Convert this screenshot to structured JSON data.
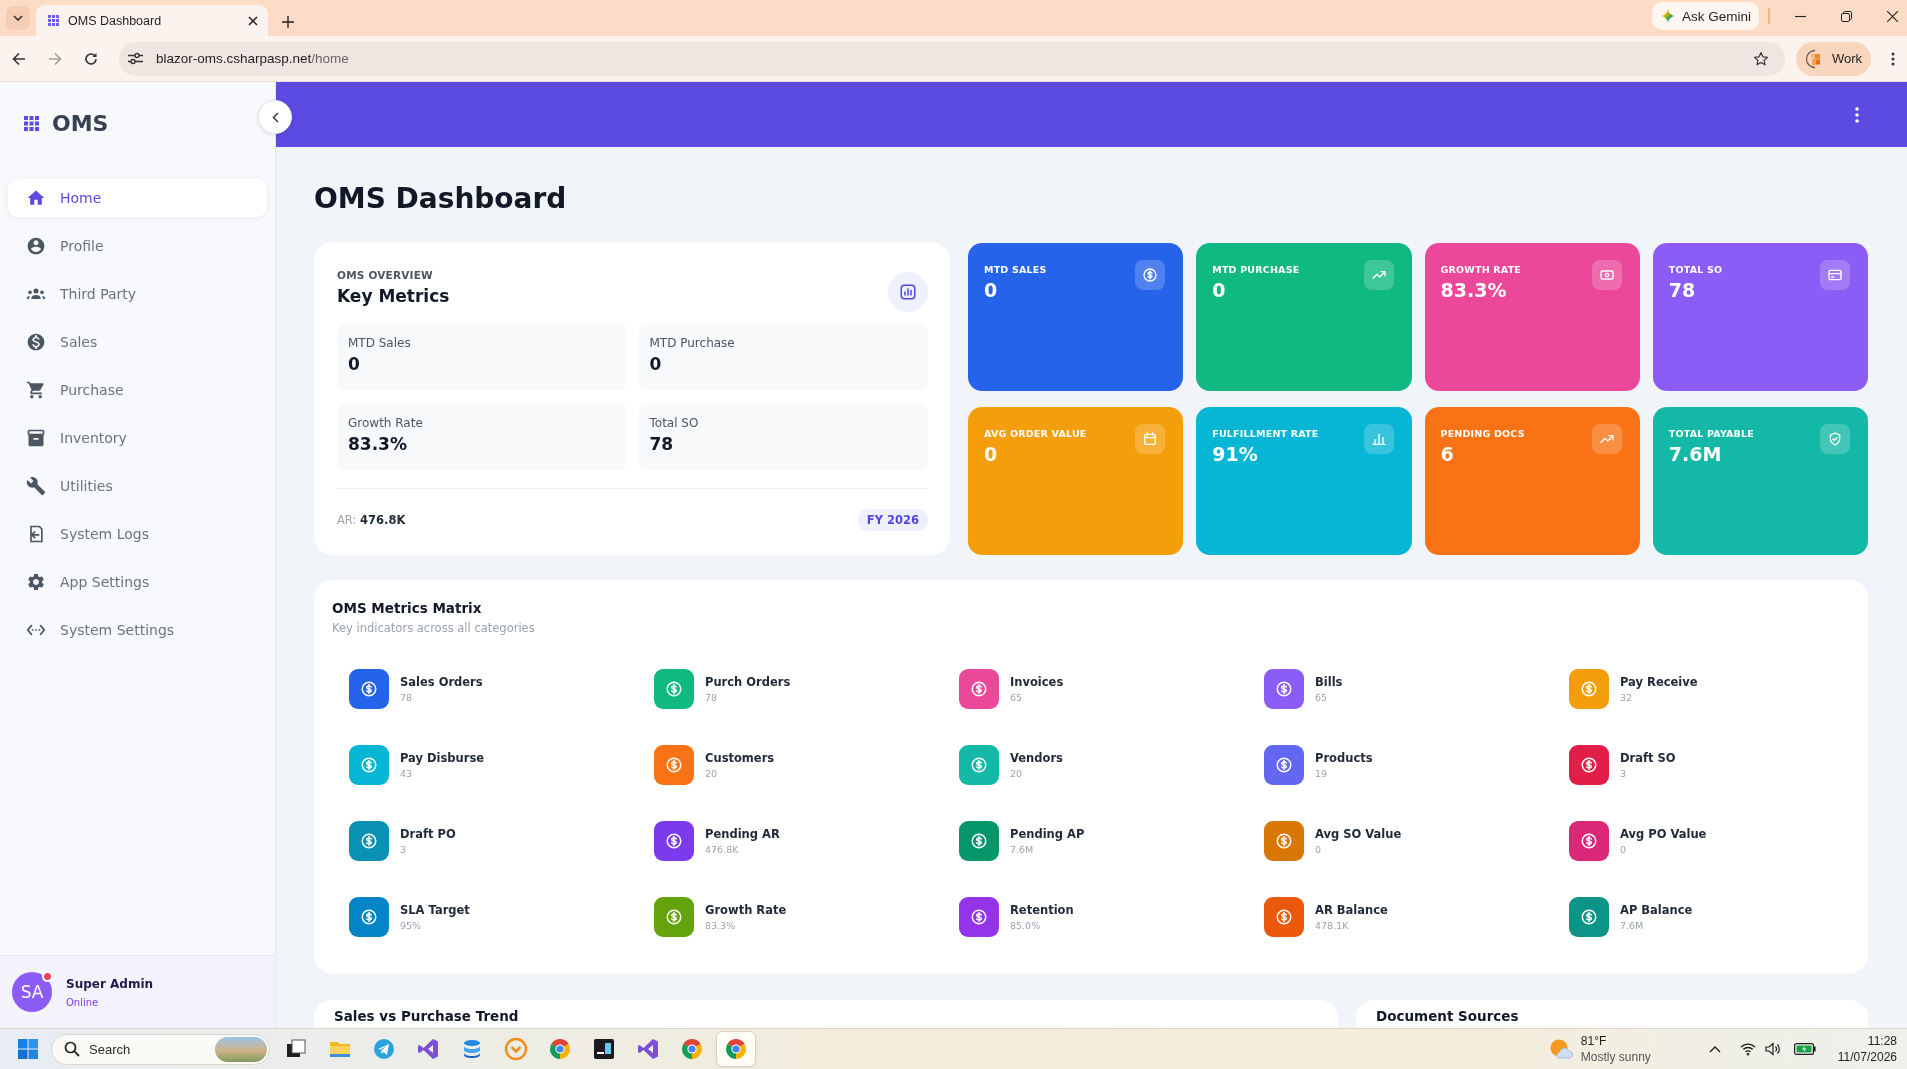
{
  "browser": {
    "tab": {
      "title": "OMS Dashboard"
    },
    "assistant_button": "Ask Gemini",
    "address": {
      "host": "blazor-oms.csharpasp.net",
      "path": "/home"
    },
    "profile_button": "Work"
  },
  "sidebar": {
    "logo": "OMS",
    "items": [
      {
        "label": "Home",
        "selected": true
      },
      {
        "label": "Profile",
        "selected": false
      },
      {
        "label": "Third Party",
        "selected": false
      },
      {
        "label": "Sales",
        "selected": false
      },
      {
        "label": "Purchase",
        "selected": false
      },
      {
        "label": "Inventory",
        "selected": false
      },
      {
        "label": "Utilities",
        "selected": false
      },
      {
        "label": "System Logs",
        "selected": false
      },
      {
        "label": "App Settings",
        "selected": false
      },
      {
        "label": "System Settings",
        "selected": false
      }
    ],
    "user": {
      "initials": "SA",
      "name": "Super Admin",
      "status": "Online"
    }
  },
  "page_title": "OMS Dashboard",
  "overview": {
    "eyebrow": "OMS OVERVIEW",
    "title": "Key Metrics",
    "metrics": [
      {
        "label": "MTD Sales",
        "value": "0"
      },
      {
        "label": "MTD Purchase",
        "value": "0"
      },
      {
        "label": "Growth Rate",
        "value": "83.3%"
      },
      {
        "label": "Total SO",
        "value": "78"
      }
    ],
    "footer_note": "AR: **476.8K**",
    "badge": "FY 2026"
  },
  "tiles": [
    {
      "label": "MTD SALES",
      "value": "0",
      "color": "#2563eb"
    },
    {
      "label": "MTD PURCHASE",
      "value": "0",
      "color": "#10b981"
    },
    {
      "label": "GROWTH RATE",
      "value": "83.3%",
      "color": "#ec4899"
    },
    {
      "label": "TOTAL SO",
      "value": "78",
      "color": "#8b5cf6"
    },
    {
      "label": "AVG ORDER VALUE",
      "value": "0",
      "color": "#f59e0b"
    },
    {
      "label": "FULFILLMENT RATE",
      "value": "91%",
      "color": "#06b6d4"
    },
    {
      "label": "PENDING DOCS",
      "value": "6",
      "color": "#f97316"
    },
    {
      "label": "TOTAL PAYABLE",
      "value": "7.6M",
      "color": "#14b8a6"
    }
  ],
  "matrix": {
    "title": "OMS Metrics Matrix",
    "subtitle": "Key indicators across all categories",
    "items": [
      {
        "name": "Sales Orders",
        "value": "78",
        "color": "#2563eb"
      },
      {
        "name": "Purch Orders",
        "value": "78",
        "color": "#10b981"
      },
      {
        "name": "Invoices",
        "value": "65",
        "color": "#ec4899"
      },
      {
        "name": "Bills",
        "value": "65",
        "color": "#8b5cf6"
      },
      {
        "name": "Pay Receive",
        "value": "32",
        "color": "#f59e0b"
      },
      {
        "name": "Pay Disburse",
        "value": "43",
        "color": "#06b6d4"
      },
      {
        "name": "Customers",
        "value": "20",
        "color": "#f97316"
      },
      {
        "name": "Vendors",
        "value": "20",
        "color": "#14b8a6"
      },
      {
        "name": "Products",
        "value": "19",
        "color": "#6366f1"
      },
      {
        "name": "Draft SO",
        "value": "3",
        "color": "#e11d48"
      },
      {
        "name": "Draft PO",
        "value": "3",
        "color": "#0891b2"
      },
      {
        "name": "Pending AR",
        "value": "476.8K",
        "color": "#7c3aed"
      },
      {
        "name": "Pending AP",
        "value": "7.6M",
        "color": "#059669"
      },
      {
        "name": "Avg SO Value",
        "value": "0",
        "color": "#d97706"
      },
      {
        "name": "Avg PO Value",
        "value": "0",
        "color": "#db2777"
      },
      {
        "name": "SLA Target",
        "value": "95%",
        "color": "#0284c7"
      },
      {
        "name": "Growth Rate",
        "value": "83.3%",
        "color": "#65a30d"
      },
      {
        "name": "Retention",
        "value": "85.0%",
        "color": "#9333ea"
      },
      {
        "name": "AR Balance",
        "value": "478.1K",
        "color": "#ea580c"
      },
      {
        "name": "AP Balance",
        "value": "7.6M",
        "color": "#0d9488"
      }
    ]
  },
  "panels": [
    {
      "title": "Sales vs Purchase Trend"
    },
    {
      "title": "Document Sources"
    }
  ],
  "taskbar": {
    "search": {
      "placeholder": "Search"
    },
    "apps": [
      {
        "selected": false
      },
      {
        "selected": false
      },
      {
        "selected": false
      },
      {
        "selected": false
      },
      {
        "selected": false
      },
      {
        "selected": false
      },
      {
        "selected": false
      },
      {
        "selected": false
      },
      {
        "selected": false
      },
      {
        "selected": false
      },
      {
        "selected": true
      }
    ],
    "weather": {
      "temperature": "81°F",
      "condition": "Mostly sunny"
    },
    "clock": {
      "time": "11:28",
      "date": "11/07/2026"
    }
  }
}
